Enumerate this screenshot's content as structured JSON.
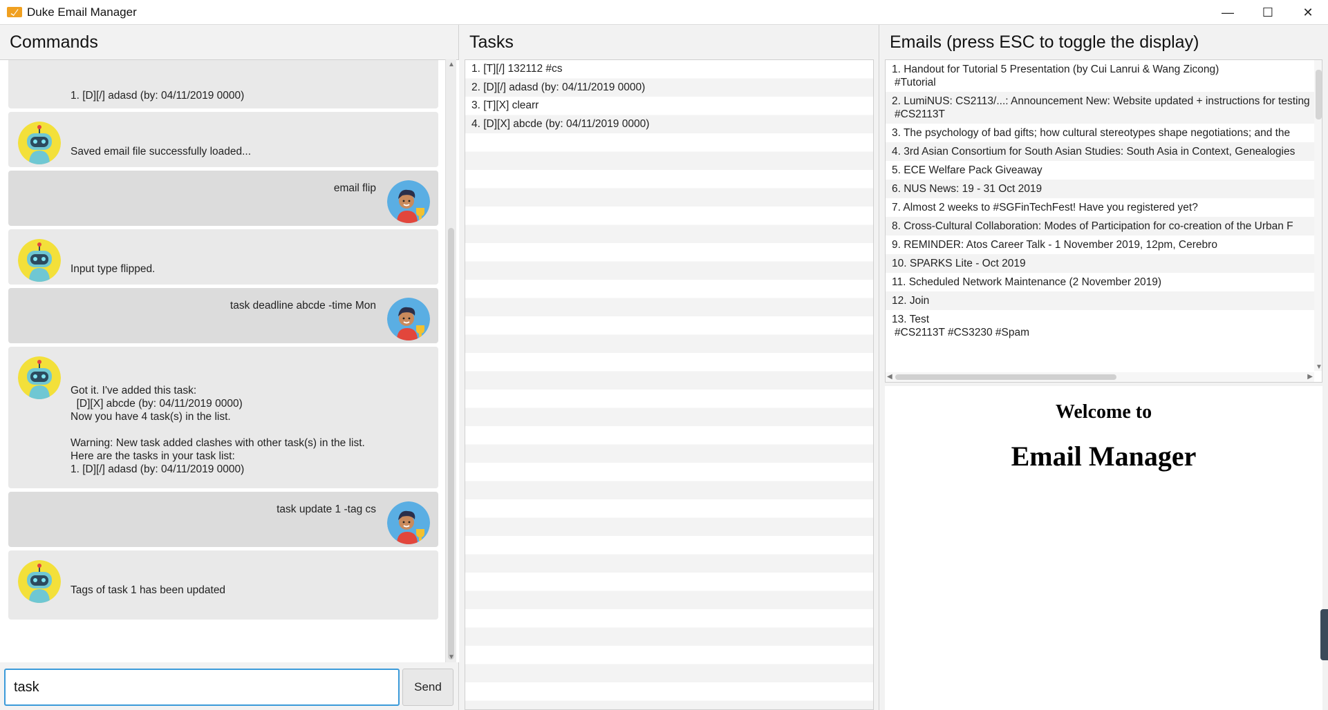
{
  "window": {
    "title": "Duke Email Manager",
    "minimize": "—",
    "maximize": "☐",
    "close": "✕"
  },
  "commands": {
    "header": "Commands",
    "messages": [
      {
        "from": "bot",
        "text": "1. [D][/] adasd (by: 04/11/2019 0000)"
      },
      {
        "from": "bot",
        "text": "Saved email file successfully loaded..."
      },
      {
        "from": "user",
        "text": "email flip"
      },
      {
        "from": "bot",
        "text": "Input type flipped."
      },
      {
        "from": "user",
        "text": "task deadline abcde -time Mon"
      },
      {
        "from": "bot",
        "text": "Got it. I've added this task:\n  [D][X] abcde (by: 04/11/2019 0000)\nNow you have 4 task(s) in the list.\n\nWarning: New task added clashes with other task(s) in the list.\nHere are the tasks in your task list:\n1. [D][/] adasd (by: 04/11/2019 0000)"
      },
      {
        "from": "user",
        "text": "task update 1 -tag cs"
      },
      {
        "from": "bot",
        "text": "Tags of task 1 has been updated"
      }
    ],
    "input_value": "task ",
    "send_label": "Send"
  },
  "tasks": {
    "header": "Tasks",
    "items": [
      "1. [T][/] 132112 #cs",
      "2. [D][/] adasd (by: 04/11/2019 0000)",
      "3. [T][X] clearr",
      "4. [D][X] abcde (by: 04/11/2019 0000)"
    ]
  },
  "emails": {
    "header": "Emails (press ESC to toggle the display)",
    "items": [
      {
        "title": "1. Handout for Tutorial 5 Presentation (by Cui Lanrui & Wang Zicong)",
        "tags": "#Tutorial"
      },
      {
        "title": "2. LumiNUS: CS2113/...: Announcement New: Website updated + instructions for testing",
        "tags": "#CS2113T"
      },
      {
        "title": "3. The psychology of bad gifts; how cultural stereotypes shape negotiations; and the",
        "tags": ""
      },
      {
        "title": "4. 3rd Asian Consortium for South Asian Studies: South Asia in Context, Genealogies",
        "tags": ""
      },
      {
        "title": "5. ECE Welfare Pack Giveaway",
        "tags": ""
      },
      {
        "title": "6. NUS News: 19 - 31 Oct 2019",
        "tags": ""
      },
      {
        "title": "7. Almost 2 weeks to #SGFinTechFest! Have you registered yet?",
        "tags": ""
      },
      {
        "title": "8. Cross-Cultural Collaboration: Modes of Participation for co-creation of the Urban F",
        "tags": ""
      },
      {
        "title": "9. REMINDER: Atos Career Talk - 1 November 2019, 12pm, Cerebro",
        "tags": ""
      },
      {
        "title": "10. SPARKS Lite - Oct 2019",
        "tags": ""
      },
      {
        "title": "11. Scheduled Network Maintenance (2 November 2019)",
        "tags": ""
      },
      {
        "title": "12. Join",
        "tags": ""
      },
      {
        "title": "13. Test",
        "tags": "#CS2113T #CS3230 #Spam"
      }
    ],
    "welcome_line1": "Welcome to",
    "welcome_line2": "Email Manager"
  },
  "colors": {
    "input_border": "#3a9ad9",
    "app_icon": "#f0a020"
  }
}
